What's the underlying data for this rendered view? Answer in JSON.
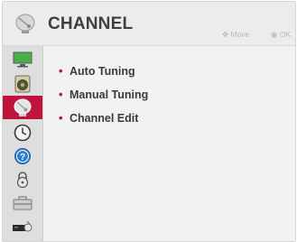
{
  "header": {
    "title": "CHANNEL",
    "hint_move": "Move",
    "hint_ok": "OK",
    "icon": "satellite-dish-icon"
  },
  "sidebar": {
    "items": [
      {
        "icon": "picture-monitor-icon",
        "active": false
      },
      {
        "icon": "audio-speaker-icon",
        "active": false
      },
      {
        "icon": "channel-dish-icon",
        "active": true
      },
      {
        "icon": "time-clock-icon",
        "active": false
      },
      {
        "icon": "help-question-icon",
        "active": false
      },
      {
        "icon": "lock-icon",
        "active": false
      },
      {
        "icon": "option-toolbox-icon",
        "active": false
      },
      {
        "icon": "network-device-icon",
        "active": false
      }
    ]
  },
  "menu": {
    "items": [
      "Auto Tuning",
      "Manual Tuning",
      "Channel Edit"
    ]
  },
  "colors": {
    "accent": "#c0143c",
    "panel_bg": "#f2f2f2",
    "sidebar_bg": "#dedede",
    "text": "#3a3a3a",
    "hint": "#b9b9b9"
  }
}
